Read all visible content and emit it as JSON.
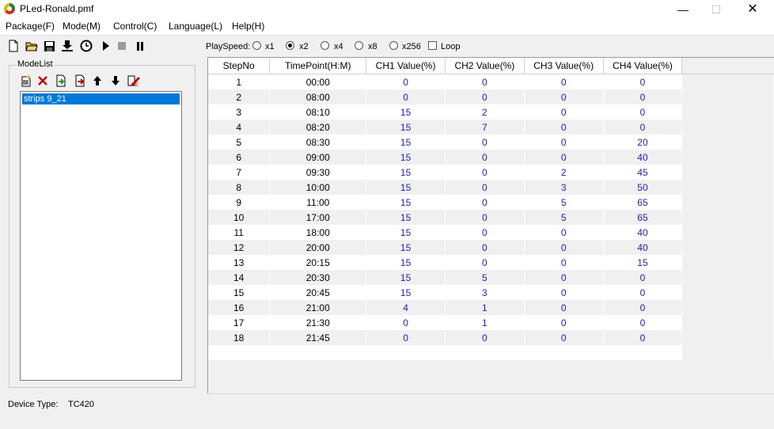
{
  "window": {
    "title": "PLed-Ronald.pmf",
    "min": "—",
    "max": "☐",
    "close": "✕"
  },
  "menu": [
    {
      "label": "Package(F)"
    },
    {
      "label": "Mode(M)"
    },
    {
      "label": "Control(C)"
    },
    {
      "label": "Language(L)"
    },
    {
      "label": "Help(H)"
    }
  ],
  "toolbar": {
    "icons": [
      "new-file-icon",
      "open-folder-icon",
      "save-icon",
      "download-icon",
      "clock-icon",
      "play-icon",
      "stop-icon",
      "pause-icon"
    ],
    "play_speed_label": "PlaySpeed:",
    "speeds": [
      {
        "label": "x1",
        "selected": false
      },
      {
        "label": "x2",
        "selected": true
      },
      {
        "label": "x4",
        "selected": false
      },
      {
        "label": "x8",
        "selected": false
      },
      {
        "label": "x256",
        "selected": false
      }
    ],
    "loop_label": "Loop",
    "loop_checked": false
  },
  "mode_list": {
    "title": "ModeList",
    "icons": [
      "new-mode-icon",
      "delete-mode-icon",
      "import-mode-icon",
      "export-mode-icon",
      "move-up-icon",
      "move-down-icon",
      "edit-mode-icon"
    ],
    "items": [
      "strips 9_21"
    ],
    "selected": 0
  },
  "device": {
    "label": "Device Type:",
    "value": "TC420"
  },
  "table": {
    "headers": [
      "StepNo",
      "TimePoint(H:M)",
      "CH1 Value(%)",
      "CH2 Value(%)",
      "CH3 Value(%)",
      "CH4 Value(%)"
    ],
    "rows": [
      [
        "1",
        "00:00",
        "0",
        "0",
        "0",
        "0"
      ],
      [
        "2",
        "08:00",
        "0",
        "0",
        "0",
        "0"
      ],
      [
        "3",
        "08:10",
        "15",
        "2",
        "0",
        "0"
      ],
      [
        "4",
        "08:20",
        "15",
        "7",
        "0",
        "0"
      ],
      [
        "5",
        "08:30",
        "15",
        "0",
        "0",
        "20"
      ],
      [
        "6",
        "09:00",
        "15",
        "0",
        "0",
        "40"
      ],
      [
        "7",
        "09:30",
        "15",
        "0",
        "2",
        "45"
      ],
      [
        "8",
        "10:00",
        "15",
        "0",
        "3",
        "50"
      ],
      [
        "9",
        "11:00",
        "15",
        "0",
        "5",
        "65"
      ],
      [
        "10",
        "17:00",
        "15",
        "0",
        "5",
        "65"
      ],
      [
        "11",
        "18:00",
        "15",
        "0",
        "0",
        "40"
      ],
      [
        "12",
        "20:00",
        "15",
        "0",
        "0",
        "40"
      ],
      [
        "13",
        "20:15",
        "15",
        "0",
        "0",
        "15"
      ],
      [
        "14",
        "20:30",
        "15",
        "5",
        "0",
        "0"
      ],
      [
        "15",
        "20:45",
        "15",
        "3",
        "0",
        "0"
      ],
      [
        "16",
        "21:00",
        "4",
        "1",
        "0",
        "0"
      ],
      [
        "17",
        "21:30",
        "0",
        "1",
        "0",
        "0"
      ],
      [
        "18",
        "21:45",
        "0",
        "0",
        "0",
        "0"
      ]
    ]
  },
  "colors": {
    "value_text": "#1f1fb0",
    "selection": "#0078d7"
  }
}
